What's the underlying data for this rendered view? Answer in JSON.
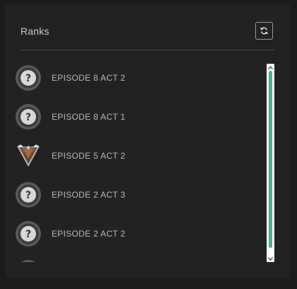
{
  "panel": {
    "title": "Ranks",
    "refresh_icon": "refresh-icon"
  },
  "ranks": {
    "items": [
      {
        "label": "EPISODE 8 ACT 2",
        "icon": "unranked-icon"
      },
      {
        "label": "EPISODE 8 ACT 1",
        "icon": "unranked-icon"
      },
      {
        "label": "EPISODE 5 ACT 2",
        "icon": "bronze-rank-icon"
      },
      {
        "label": "EPISODE 2 ACT 3",
        "icon": "unranked-icon"
      },
      {
        "label": "EPISODE 2 ACT 2",
        "icon": "unranked-icon"
      },
      {
        "label": "",
        "icon": "unranked-icon"
      }
    ]
  },
  "scrollbar": {
    "position_fraction": 0.0,
    "thumb_color": "#4fae91"
  },
  "colors": {
    "background": "#1c1c1c",
    "panel": "#222222",
    "text": "#b9b9b9",
    "accent": "#4fae91"
  }
}
